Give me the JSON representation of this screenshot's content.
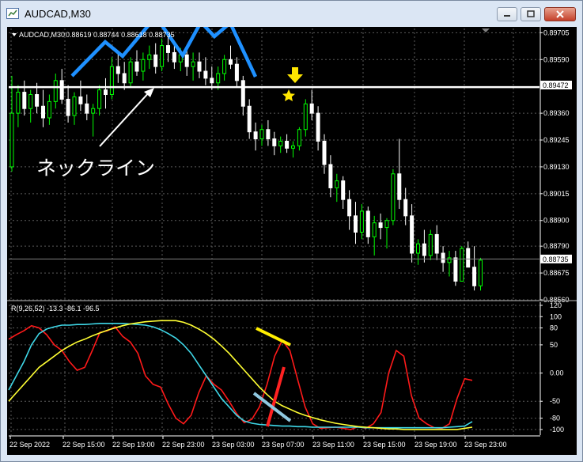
{
  "window": {
    "title": "AUDCAD,M30"
  },
  "price_panel": {
    "header_symbol": "AUDCAD,M30",
    "header_values": "0.88619 0.88744 0.88618 0.88735",
    "annotation": "ネックライン",
    "horizontal_line_price": "0.89472",
    "current_price": "0.88735"
  },
  "indicator_panel": {
    "header": "R(9,26,52) -13.3 -86.1 -96.5"
  },
  "colors": {
    "background": "#000000",
    "bull": "#00ff00",
    "bear": "#ffffff",
    "pattern": "#1e90ff",
    "neckline": "#ffffff",
    "arrow": "#ffee00",
    "red_line": "#ff1a1a",
    "cyan_line": "#3fd8e8",
    "yellow_line": "#ffff33"
  },
  "chart_data": [
    {
      "type": "candlestick",
      "title": "AUDCAD,M30",
      "ylim": [
        0.8856,
        0.8973
      ],
      "y_ticks": [
        "0.89705",
        "0.89590",
        "0.89472",
        "0.89360",
        "0.89245",
        "0.89130",
        "0.89015",
        "0.88900",
        "0.88790",
        "0.88735",
        "0.88675",
        "0.88560"
      ],
      "x_ticks": [
        "22 Sep 2022",
        "22 Sep 15:00",
        "22 Sep 19:00",
        "22 Sep 23:00",
        "23 Sep 03:00",
        "23 Sep 07:00",
        "23 Sep 11:00",
        "23 Sep 15:00",
        "23 Sep 19:00",
        "23 Sep 23:00"
      ],
      "neckline": 0.89472,
      "candles": [
        [
          0.8913,
          0.8952,
          0.8911,
          0.8936
        ],
        [
          0.8936,
          0.8948,
          0.893,
          0.8945
        ],
        [
          0.8945,
          0.895,
          0.8935,
          0.8938
        ],
        [
          0.8938,
          0.8946,
          0.8932,
          0.8944
        ],
        [
          0.8944,
          0.8949,
          0.8936,
          0.8939
        ],
        [
          0.8939,
          0.8946,
          0.893,
          0.8934
        ],
        [
          0.8934,
          0.8944,
          0.8931,
          0.8941
        ],
        [
          0.8941,
          0.8953,
          0.8938,
          0.895
        ],
        [
          0.895,
          0.8955,
          0.894,
          0.8942
        ],
        [
          0.8942,
          0.8948,
          0.8932,
          0.8935
        ],
        [
          0.8935,
          0.8945,
          0.8931,
          0.8943
        ],
        [
          0.8943,
          0.895,
          0.8937,
          0.894
        ],
        [
          0.894,
          0.8944,
          0.8933,
          0.8936
        ],
        [
          0.8936,
          0.894,
          0.8926,
          0.8938
        ],
        [
          0.8938,
          0.8948,
          0.8935,
          0.8946
        ],
        [
          0.8946,
          0.8951,
          0.8938,
          0.8944
        ],
        [
          0.8944,
          0.896,
          0.8942,
          0.8956
        ],
        [
          0.8956,
          0.8962,
          0.8949,
          0.8953
        ],
        [
          0.8953,
          0.8958,
          0.8946,
          0.8949
        ],
        [
          0.8949,
          0.896,
          0.8947,
          0.8958
        ],
        [
          0.8958,
          0.8963,
          0.8952,
          0.8954
        ],
        [
          0.8954,
          0.8962,
          0.895,
          0.8959
        ],
        [
          0.8959,
          0.8965,
          0.8955,
          0.8961
        ],
        [
          0.8961,
          0.8966,
          0.8953,
          0.8956
        ],
        [
          0.8956,
          0.8968,
          0.8954,
          0.8965
        ],
        [
          0.8965,
          0.897,
          0.8958,
          0.8962
        ],
        [
          0.8962,
          0.8967,
          0.8955,
          0.8958
        ],
        [
          0.8958,
          0.8964,
          0.8954,
          0.8961
        ],
        [
          0.8961,
          0.8965,
          0.8952,
          0.8956
        ],
        [
          0.8956,
          0.8962,
          0.895,
          0.8958
        ],
        [
          0.8958,
          0.8962,
          0.8951,
          0.8954
        ],
        [
          0.8954,
          0.896,
          0.8948,
          0.8951
        ],
        [
          0.8951,
          0.8956,
          0.8946,
          0.8949
        ],
        [
          0.8949,
          0.8956,
          0.8946,
          0.8953
        ],
        [
          0.8953,
          0.8961,
          0.895,
          0.8959
        ],
        [
          0.8959,
          0.8965,
          0.8955,
          0.8957
        ],
        [
          0.8957,
          0.896,
          0.8947,
          0.895
        ],
        [
          0.895,
          0.8952,
          0.8935,
          0.8939
        ],
        [
          0.8939,
          0.8942,
          0.8925,
          0.8928
        ],
        [
          0.8928,
          0.8932,
          0.892,
          0.8925
        ],
        [
          0.8925,
          0.8931,
          0.8922,
          0.8929
        ],
        [
          0.8929,
          0.8933,
          0.8922,
          0.8925
        ],
        [
          0.8925,
          0.8928,
          0.8918,
          0.8922
        ],
        [
          0.8922,
          0.8926,
          0.8919,
          0.8924
        ],
        [
          0.8924,
          0.8927,
          0.8919,
          0.8921
        ],
        [
          0.8921,
          0.8924,
          0.8917,
          0.8922
        ],
        [
          0.8922,
          0.893,
          0.892,
          0.8929
        ],
        [
          0.8929,
          0.8942,
          0.8926,
          0.894
        ],
        [
          0.894,
          0.8946,
          0.8933,
          0.8936
        ],
        [
          0.8936,
          0.8939,
          0.892,
          0.8924
        ],
        [
          0.8924,
          0.8927,
          0.891,
          0.8914
        ],
        [
          0.8914,
          0.8918,
          0.89,
          0.8904
        ],
        [
          0.8904,
          0.891,
          0.8898,
          0.8907
        ],
        [
          0.8907,
          0.8909,
          0.8895,
          0.8899
        ],
        [
          0.8899,
          0.8903,
          0.8886,
          0.8892
        ],
        [
          0.8892,
          0.8898,
          0.888,
          0.8885
        ],
        [
          0.8885,
          0.8897,
          0.8882,
          0.8894
        ],
        [
          0.8894,
          0.8896,
          0.888,
          0.8883
        ],
        [
          0.8883,
          0.8892,
          0.8875,
          0.8889
        ],
        [
          0.8889,
          0.8893,
          0.8882,
          0.8887
        ],
        [
          0.8887,
          0.8891,
          0.8878,
          0.889
        ],
        [
          0.889,
          0.8912,
          0.8888,
          0.891
        ],
        [
          0.891,
          0.8925,
          0.8895,
          0.8899
        ],
        [
          0.8899,
          0.8904,
          0.8888,
          0.8892
        ],
        [
          0.8892,
          0.8897,
          0.8872,
          0.8876
        ],
        [
          0.8876,
          0.8882,
          0.8871,
          0.888
        ],
        [
          0.888,
          0.8886,
          0.8872,
          0.8875
        ],
        [
          0.8875,
          0.8886,
          0.8873,
          0.8884
        ],
        [
          0.8884,
          0.8888,
          0.8873,
          0.8876
        ],
        [
          0.8876,
          0.8879,
          0.8868,
          0.8872
        ],
        [
          0.8872,
          0.8877,
          0.8866,
          0.8874
        ],
        [
          0.8874,
          0.8877,
          0.8862,
          0.8864
        ],
        [
          0.8864,
          0.8879,
          0.8864,
          0.8878
        ],
        [
          0.8878,
          0.8881,
          0.887,
          0.887
        ],
        [
          0.887,
          0.8879,
          0.886,
          0.8862
        ],
        [
          0.8862,
          0.8874,
          0.886,
          0.8873
        ]
      ]
    },
    {
      "type": "line",
      "title": "R(9,26,52)",
      "ylim": [
        -110,
        120
      ],
      "y_ticks": [
        "120",
        "100",
        "80",
        "50",
        "0.00",
        "-50",
        "-80",
        "-100"
      ],
      "series": [
        {
          "name": "R(9)",
          "values": [
            60,
            68,
            75,
            84,
            80,
            68,
            50,
            40,
            20,
            5,
            10,
            40,
            72,
            75,
            82,
            65,
            55,
            35,
            -5,
            -20,
            -25,
            -55,
            -80,
            -90,
            -75,
            -35,
            -5,
            -20,
            -30,
            -50,
            -72,
            -88,
            -82,
            -60,
            -20,
            30,
            58,
            40,
            -10,
            -60,
            -90,
            -98,
            -97,
            -96,
            -98,
            -100,
            -95,
            -98,
            -90,
            -70,
            0,
            40,
            30,
            -40,
            -80,
            -90,
            -97,
            -98,
            -90,
            -45,
            -10,
            -13
          ]
        },
        {
          "name": "R(26)",
          "values": [
            -30,
            -5,
            20,
            50,
            70,
            78,
            82,
            85,
            85,
            86,
            86,
            87,
            88,
            88,
            88,
            88,
            87,
            86,
            85,
            82,
            77,
            70,
            62,
            50,
            35,
            15,
            -5,
            -25,
            -45,
            -60,
            -75,
            -85,
            -89,
            -91,
            -92,
            -93,
            -94,
            -94,
            -95,
            -95,
            -96,
            -96,
            -96,
            -96,
            -96,
            -96,
            -96,
            -97,
            -97,
            -97,
            -97,
            -97,
            -97,
            -97,
            -97,
            -97,
            -97,
            -97,
            -96,
            -95,
            -94,
            -86
          ]
        },
        {
          "name": "R(52)",
          "values": [
            -50,
            -35,
            -20,
            -5,
            10,
            20,
            30,
            40,
            48,
            55,
            60,
            66,
            71,
            76,
            80,
            84,
            87,
            89,
            91,
            92,
            93,
            93,
            93,
            90,
            85,
            78,
            70,
            60,
            48,
            35,
            20,
            5,
            -10,
            -25,
            -38,
            -50,
            -58,
            -64,
            -70,
            -75,
            -79,
            -83,
            -86,
            -89,
            -91,
            -93,
            -95,
            -96,
            -97,
            -98,
            -99,
            -99,
            -100,
            -100,
            -100,
            -100,
            -100,
            -100,
            -100,
            -100,
            -98,
            -96
          ]
        }
      ]
    }
  ]
}
